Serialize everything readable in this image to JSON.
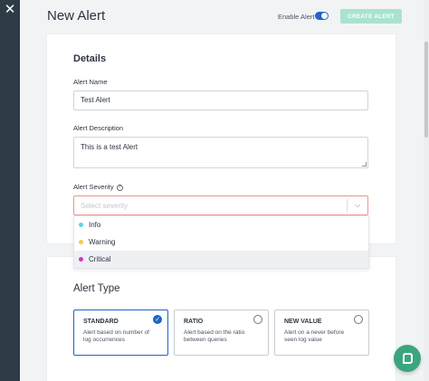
{
  "header": {
    "title": "New Alert",
    "enable_label": "Enable Alert",
    "enabled": true,
    "create_button": "CREATE ALERT"
  },
  "icons": {
    "close": "close-icon",
    "help": "question-circle-icon",
    "chevron": "chevron-down-icon",
    "check": "checkmark-icon",
    "chat": "chat-icon"
  },
  "colors": {
    "primary": "#1f64c8",
    "create_button": "#a9e3cf",
    "chat_button": "#3aa680",
    "error_border": "#e8958f",
    "sidebar": "#2f3a47"
  },
  "details": {
    "title": "Details",
    "name_label": "Alert Name",
    "name_value": "Test Alert",
    "description_label": "Alert Description",
    "description_value": "This is a test Alert",
    "severity_label": "Alert Severity",
    "severity_placeholder": "Select severity",
    "severity_options": [
      {
        "label": "Info",
        "color": "#5fd3e8"
      },
      {
        "label": "Warning",
        "color": "#f2cb4a"
      },
      {
        "label": "Critical",
        "color": "#c73ac9"
      }
    ]
  },
  "alert_type": {
    "title": "Alert Type",
    "options": [
      {
        "name": "STANDARD",
        "description": "Alert based on number of log occurrences",
        "selected": true
      },
      {
        "name": "RATIO",
        "description": "Alert based on the ratio between queries",
        "selected": false
      },
      {
        "name": "NEW VALUE",
        "description": "Alert on a never before seen log value",
        "selected": false
      }
    ]
  }
}
